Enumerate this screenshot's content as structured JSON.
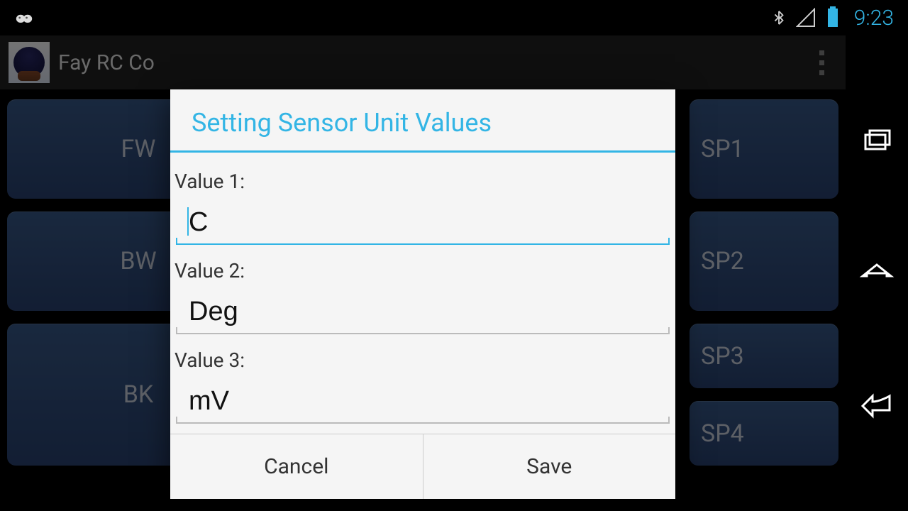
{
  "status_bar": {
    "clock": "9:23"
  },
  "app_bar": {
    "title": "Fay RC Co"
  },
  "rc_buttons": {
    "left": [
      "FW",
      "BW",
      "BK"
    ],
    "right": [
      "SP1",
      "SP2",
      "SP3",
      "SP4"
    ]
  },
  "dialog": {
    "title": "Setting Sensor Unit Values",
    "fields": [
      {
        "label": "Value 1:",
        "value": "C"
      },
      {
        "label": "Value 2:",
        "value": "Deg"
      },
      {
        "label": "Value 3:",
        "value": "mV"
      }
    ],
    "cancel": "Cancel",
    "save": "Save"
  }
}
